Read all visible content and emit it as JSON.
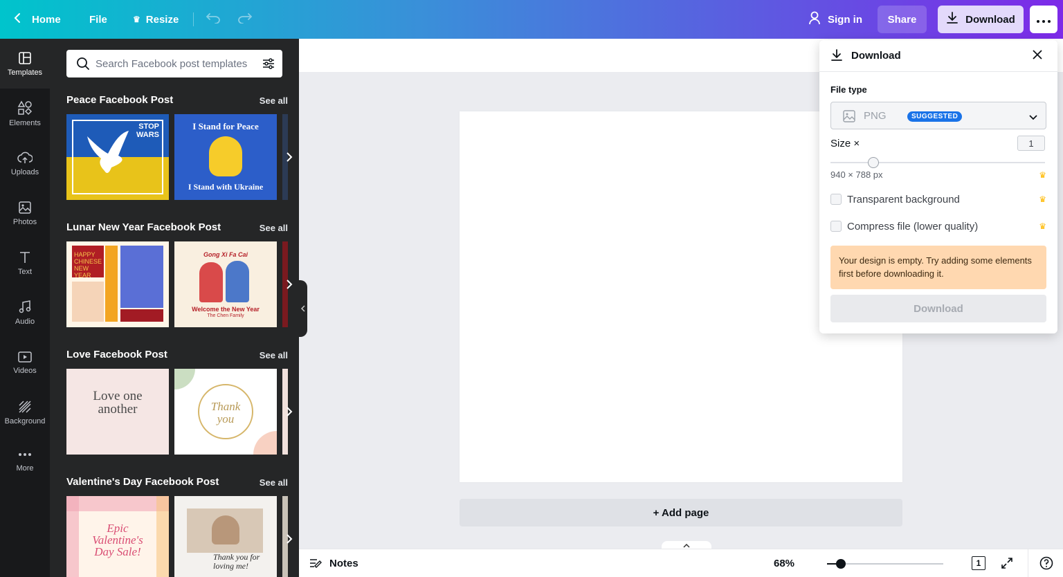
{
  "topbar": {
    "home_label": "Home",
    "file_label": "File",
    "resize_label": "Resize",
    "signin_label": "Sign in",
    "share_label": "Share",
    "download_label": "Download"
  },
  "sidebar": {
    "items": [
      {
        "label": "Templates",
        "icon": "templates-icon"
      },
      {
        "label": "Elements",
        "icon": "elements-icon"
      },
      {
        "label": "Uploads",
        "icon": "upload-icon"
      },
      {
        "label": "Photos",
        "icon": "photo-icon"
      },
      {
        "label": "Text",
        "icon": "text-icon"
      },
      {
        "label": "Audio",
        "icon": "audio-icon"
      },
      {
        "label": "Videos",
        "icon": "video-icon"
      },
      {
        "label": "Background",
        "icon": "background-icon"
      },
      {
        "label": "More",
        "icon": "more-icon"
      }
    ]
  },
  "panel": {
    "search_placeholder": "Search Facebook post templates",
    "see_all": "See all",
    "sections": [
      {
        "title": "Peace Facebook Post",
        "templates": [
          {
            "text": "STOP WARS"
          },
          {
            "text_top": "I Stand for Peace",
            "text_bottom": "I Stand with Ukraine"
          }
        ]
      },
      {
        "title": "Lunar New Year Facebook Post",
        "templates": [
          {
            "text": "HAPPY CHINESE NEW YEAR"
          },
          {
            "text_top": "Gong Xi Fa Cai",
            "text_bottom": "Welcome the New Year",
            "text_sub": "The Chen Family"
          }
        ]
      },
      {
        "title": "Love Facebook Post",
        "templates": [
          {
            "text": "Love one another"
          },
          {
            "text": "Thank you"
          }
        ]
      },
      {
        "title": "Valentine's Day Facebook Post",
        "templates": [
          {
            "text": "Epic Valentine's Day Sale!"
          },
          {
            "text": "Thank you for loving me!"
          }
        ]
      }
    ]
  },
  "canvas": {
    "add_page_label": "+ Add page"
  },
  "footer": {
    "notes_label": "Notes",
    "zoom": "68%",
    "zoom_level": 0.68,
    "page_count": "1"
  },
  "download_panel": {
    "title": "Download",
    "file_type_label": "File type",
    "file_type_value": "PNG",
    "file_type_badge": "SUGGESTED",
    "size_label": "Size ×",
    "size_value": "1",
    "dimensions": "940 × 788 px",
    "transparent_label": "Transparent background",
    "compress_label": "Compress file (lower quality)",
    "warning": "Your design is empty. Try adding some elements first before downloading it.",
    "download_button": "Download"
  },
  "colors": {
    "accent": "#7d2ae8",
    "teal": "#00c4cc",
    "sidebar_bg": "#18191b",
    "panel_bg": "#252627",
    "warning_bg": "#ffd8b0",
    "badge_blue": "#1a73e8",
    "crown_gold": "#ffb900"
  }
}
